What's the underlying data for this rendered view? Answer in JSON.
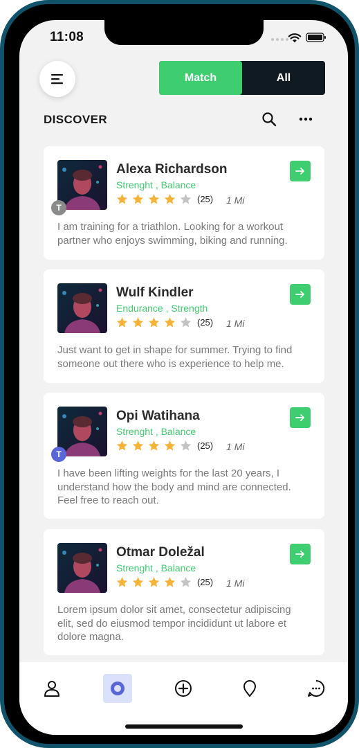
{
  "status_bar": {
    "time": "11:08"
  },
  "header": {
    "menu_icon": "menu-icon",
    "toggle": {
      "match_label": "Match",
      "all_label": "All",
      "active": "Match"
    }
  },
  "section": {
    "title": "DISCOVER",
    "search_icon": "search-icon",
    "more_icon": "more-icon"
  },
  "cards": [
    {
      "name": "Alexa Richardson",
      "tags": "Strenght , Balance",
      "rating": 4,
      "reviews": "(25)",
      "distance": "1 Mi",
      "badge": "T",
      "bio": "I am training for a triathlon. Looking for a workout partner who enjoys swimming, biking and running."
    },
    {
      "name": "Wulf Kindler",
      "tags": "Endurance , Strength",
      "rating": 4,
      "reviews": "(25)",
      "distance": "1 Mi",
      "badge": "",
      "bio": "Just want to get in shape for summer. Trying to find someone out there who is experience to help me."
    },
    {
      "name": "Opi Watihana",
      "tags": "Strenght , Balance",
      "rating": 4,
      "reviews": "(25)",
      "distance": "1 Mi",
      "badge": "T",
      "bio": "I have been lifting weights for the last 20 years, I understand how the body and mind are connected. Feel free to reach out."
    },
    {
      "name": "Otmar Doležal",
      "tags": "Strenght , Balance",
      "rating": 4,
      "reviews": "(25)",
      "distance": "1 Mi",
      "badge": "",
      "bio": "Lorem ipsum dolor sit amet, consectetur adipiscing elit, sed do eiusmod tempor incididunt ut labore et dolore magna."
    }
  ],
  "bottom_nav": [
    {
      "icon": "profile-icon",
      "active": false
    },
    {
      "icon": "discover-icon",
      "active": true
    },
    {
      "icon": "add-icon",
      "active": false
    },
    {
      "icon": "location-icon",
      "active": false
    },
    {
      "icon": "chat-icon",
      "active": false
    }
  ],
  "colors": {
    "accent": "#3ecd6f",
    "dark": "#0f1a22",
    "star": "#f5b33a",
    "star_empty": "#c4c4c4",
    "nav_active": "#5866d8",
    "frame": "#10536b"
  }
}
